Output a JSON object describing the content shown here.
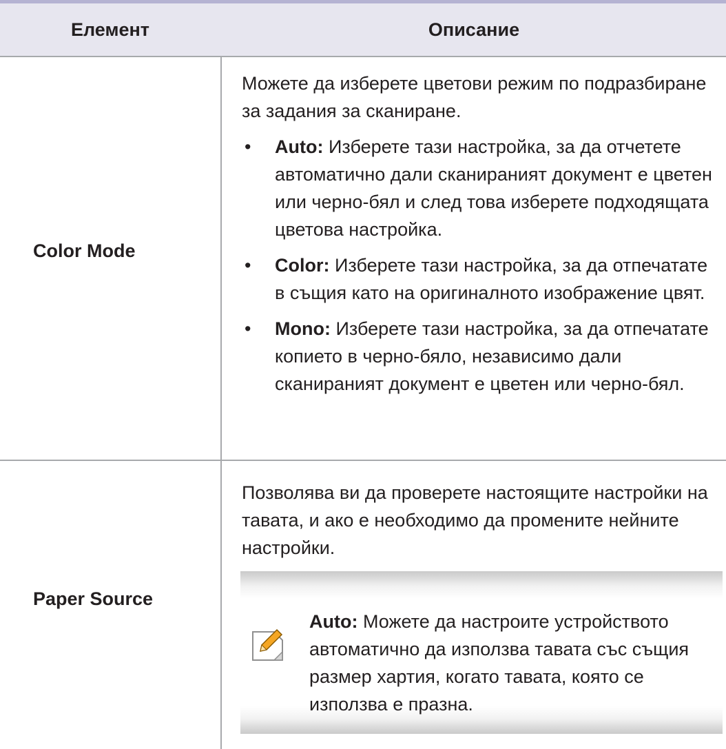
{
  "table": {
    "header": {
      "element": "Елемент",
      "description": "Описание"
    },
    "rows": [
      {
        "element": "Color Mode",
        "intro": "Можете да изберете цветови режим по подразбиране за задания за сканиране.",
        "bullets": [
          {
            "term": "Auto:",
            "text": " Изберете тази настройка, за да отчетете автоматично дали сканираният документ е цветен или черно-бял и след това изберете подходящата цветова настройка."
          },
          {
            "term": "Color:",
            "text": " Изберете тази настройка, за да отпечатате в същия като на оригиналното изображение цвят."
          },
          {
            "term": "Mono:",
            "text": " Изберете тази настройка, за да отпечатате копието в черно-бяло, независимо дали сканираният документ е цветен или черно-бял."
          }
        ]
      },
      {
        "element": "Paper Source",
        "intro": "Позволява ви да проверете настоящите настройки на тавата, и ако е необходимо да промените нейните настройки.",
        "note": {
          "icon": "note-pencil-icon",
          "term": "Auto:",
          "text": " Можете да настроите устройството автоматично да използва тавата със същия размер хартия, когато тавата, която се използва е празна."
        }
      }
    ]
  },
  "colors": {
    "top_rule": "#b5b3d2",
    "header_bg": "#e7e6ef",
    "grid": "#a7a9ac",
    "icon_accent": "#f5a623"
  }
}
